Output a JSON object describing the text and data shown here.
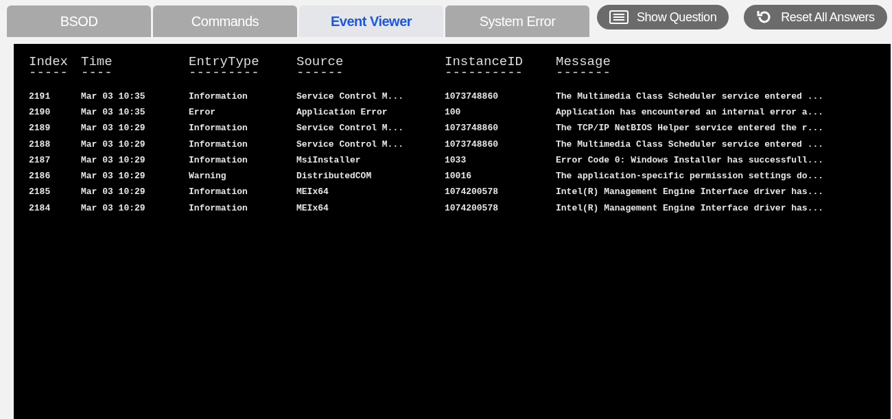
{
  "tabs": [
    {
      "label": "BSOD",
      "selected": false
    },
    {
      "label": "Commands",
      "selected": false
    },
    {
      "label": "Event Viewer",
      "selected": true
    },
    {
      "label": "System Error",
      "selected": false
    }
  ],
  "buttons": [
    {
      "label": "Show Question",
      "kind": "question"
    },
    {
      "label": "Reset All Answers",
      "kind": "reset"
    }
  ],
  "table": {
    "columns": [
      {
        "label": "Index",
        "underline": "-----"
      },
      {
        "label": "Time",
        "underline": "----"
      },
      {
        "label": "EntryType",
        "underline": "---------"
      },
      {
        "label": "Source",
        "underline": "------"
      },
      {
        "label": "InstanceID",
        "underline": "----------"
      },
      {
        "label": "Message",
        "underline": "-------"
      }
    ],
    "rows": [
      [
        "2191",
        "Mar 03 10:35",
        "Information",
        "Service Control M...",
        "1073748860",
        "The Multimedia Class Scheduler service entered ..."
      ],
      [
        "2190",
        "Mar 03 10:35",
        "Error",
        "Application Error",
        "100",
        "Application has encountered an internal error a..."
      ],
      [
        "2189",
        "Mar 03 10:29",
        "Information",
        "Service Control M...",
        "1073748860",
        "The TCP/IP NetBIOS Helper service entered the r..."
      ],
      [
        "2188",
        "Mar 03 10:29",
        "Information",
        "Service Control M...",
        "1073748860",
        "The Multimedia Class Scheduler service entered ..."
      ],
      [
        "2187",
        "Mar 03 10:29",
        "Information",
        "MsiInstaller",
        "1033",
        "Error Code 0: Windows Installer has successfull..."
      ],
      [
        "2186",
        "Mar 03 10:29",
        "Warning",
        "DistributedCOM",
        "10016",
        "The application-specific permission settings do..."
      ],
      [
        "2185",
        "Mar 03 10:29",
        "Information",
        "MEIx64",
        "1074200578",
        "Intel(R) Management Engine Interface driver has..."
      ],
      [
        "2184",
        "Mar 03 10:29",
        "Information",
        "MEIx64",
        "1074200578",
        "Intel(R) Management Engine Interface driver has..."
      ]
    ]
  }
}
